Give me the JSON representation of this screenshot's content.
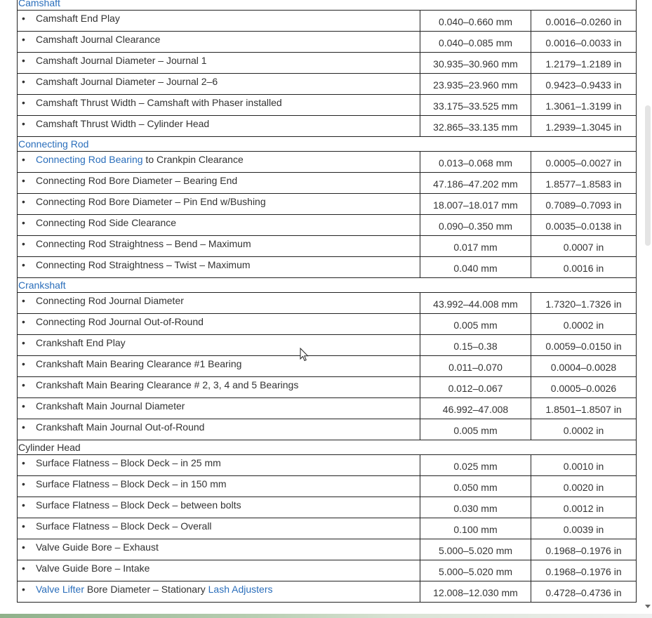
{
  "sections": [
    {
      "title": "Camshaft",
      "title_link": true,
      "rows": [
        {
          "name": "Camshaft End Play",
          "metric": "0.040–0.660 mm",
          "imperial": "0.0016–0.0260 in"
        },
        {
          "name": "Camshaft Journal Clearance",
          "metric": "0.040–0.085 mm",
          "imperial": "0.0016–0.0033 in"
        },
        {
          "name": "Camshaft Journal Diameter – Journal 1",
          "metric": "30.935–30.960 mm",
          "imperial": "1.2179–1.2189 in"
        },
        {
          "name": "Camshaft Journal Diameter – Journal 2–6",
          "metric": "23.935–23.960 mm",
          "imperial": "0.9423–0.9433 in"
        },
        {
          "name": "Camshaft Thrust Width – Camshaft with Phaser installed",
          "metric": "33.175–33.525 mm",
          "imperial": "1.3061–1.3199 in"
        },
        {
          "name": "Camshaft Thrust Width – Cylinder Head",
          "metric": "32.865–33.135 mm",
          "imperial": "1.2939–1.3045 in"
        }
      ]
    },
    {
      "title": "Connecting Rod",
      "title_link": true,
      "rows": [
        {
          "name_link": "Connecting Rod Bearing",
          "name": " to Crankpin Clearance",
          "metric": "0.013–0.068 mm",
          "imperial": "0.0005–0.0027 in"
        },
        {
          "name": "Connecting Rod Bore Diameter – Bearing End",
          "metric": "47.186–47.202 mm",
          "imperial": "1.8577–1.8583 in"
        },
        {
          "name": "Connecting Rod Bore Diameter – Pin End w/Bushing",
          "metric": "18.007–18.017 mm",
          "imperial": "0.7089–0.7093 in"
        },
        {
          "name": "Connecting Rod Side Clearance",
          "metric": "0.090–0.350 mm",
          "imperial": "0.0035–0.0138 in"
        },
        {
          "name": "Connecting Rod Straightness – Bend – Maximum",
          "metric": "0.017 mm",
          "imperial": "0.0007 in"
        },
        {
          "name": "Connecting Rod Straightness – Twist – Maximum",
          "metric": "0.040 mm",
          "imperial": "0.0016 in"
        }
      ]
    },
    {
      "title": "Crankshaft",
      "title_link": true,
      "rows": [
        {
          "name": "Connecting Rod Journal Diameter",
          "metric": "43.992–44.008 mm",
          "imperial": "1.7320–1.7326 in"
        },
        {
          "name": "Connecting Rod Journal Out-of-Round",
          "metric": "0.005 mm",
          "imperial": "0.0002 in"
        },
        {
          "name": "Crankshaft End Play",
          "metric": "0.15–0.38",
          "imperial": "0.0059–0.0150 in"
        },
        {
          "name": "Crankshaft Main Bearing Clearance #1 Bearing",
          "metric": "0.011–0.070",
          "imperial": "0.0004–0.0028"
        },
        {
          "name": "Crankshaft Main Bearing Clearance # 2, 3, 4 and 5 Bearings",
          "metric": "0.012–0.067",
          "imperial": "0.0005–0.0026"
        },
        {
          "name": "Crankshaft Main Journal Diameter",
          "metric": "46.992–47.008",
          "imperial": "1.8501–1.8507 in"
        },
        {
          "name": "Crankshaft Main Journal Out-of-Round",
          "metric": "0.005 mm",
          "imperial": "0.0002 in"
        }
      ]
    },
    {
      "title": "Cylinder Head",
      "title_link": false,
      "rows": [
        {
          "name": "Surface Flatness – Block Deck – in 25 mm",
          "metric": "0.025 mm",
          "imperial": "0.0010 in"
        },
        {
          "name": "Surface Flatness – Block Deck – in 150 mm",
          "metric": "0.050 mm",
          "imperial": "0.0020 in"
        },
        {
          "name": "Surface Flatness – Block Deck – between bolts",
          "metric": "0.030 mm",
          "imperial": "0.0012 in"
        },
        {
          "name": "Surface Flatness – Block Deck – Overall",
          "metric": "0.100 mm",
          "imperial": "0.0039 in"
        },
        {
          "name": "Valve Guide Bore – Exhaust",
          "metric": "5.000–5.020 mm",
          "imperial": "0.1968–0.1976 in"
        },
        {
          "name": "Valve Guide Bore – Intake",
          "metric": "5.000–5.020 mm",
          "imperial": "0.1968–0.1976 in"
        },
        {
          "name_link": "Valve Lifter",
          "name": " Bore Diameter – Stationary ",
          "name_link2": "Lash Adjusters",
          "metric": "12.008–12.030 mm",
          "imperial": "0.4728–0.4736 in"
        }
      ]
    }
  ],
  "bullet": "•",
  "icons": {
    "cursor": "mouse-pointer-icon",
    "scroll_down": "scroll-down-arrow-icon"
  }
}
